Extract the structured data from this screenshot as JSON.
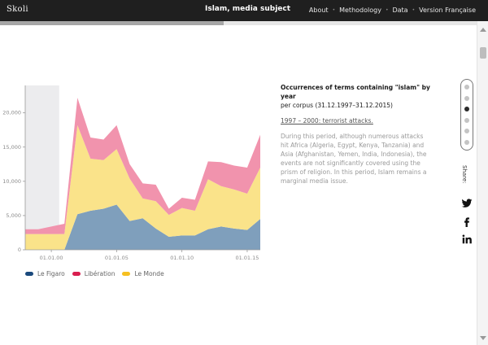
{
  "header": {
    "logo": "Skoli",
    "title": "Islam, media subject",
    "nav": [
      {
        "label": "About"
      },
      {
        "label": "Methodology"
      },
      {
        "label": "Data"
      },
      {
        "label": "Version Française"
      }
    ]
  },
  "progress": {
    "value": 0.47
  },
  "panel": {
    "heading": "Occurrences of terms containing \"islam\" by year",
    "subheading": "per corpus (31.12.1997–31.12.2015)",
    "period_link": "1997 – 2000: terrorist attacks.",
    "body": "During this period, although numerous attacks hit Africa (Algeria, Egypt, Kenya, Tanzania) and Asia (Afghanistan, Yemen, India, Indonesia), the events are not significantly covered using the prism of religion. In this period, Islam remains a marginal media issue."
  },
  "stepper": {
    "steps": 6,
    "active_index": 2
  },
  "share": {
    "label": "Share:",
    "icons": [
      "twitter-icon",
      "facebook-icon",
      "linkedin-icon"
    ]
  },
  "chart_data": {
    "type": "area",
    "stacked": true,
    "x": [
      1998,
      1999,
      2000,
      2001,
      2002,
      2003,
      2004,
      2005,
      2006,
      2007,
      2008,
      2009,
      2010,
      2011,
      2012,
      2013,
      2014,
      2015,
      2016
    ],
    "x_ticks": [
      {
        "year": 2000,
        "label": "01.01.00"
      },
      {
        "year": 2005,
        "label": "01.01.05"
      },
      {
        "year": 2010,
        "label": "01.01.10"
      },
      {
        "year": 2015,
        "label": "01.01.15"
      }
    ],
    "y_ticks": [
      {
        "value": 0,
        "label": "0"
      },
      {
        "value": 5000,
        "label": "5,000"
      },
      {
        "value": 10000,
        "label": "10,000"
      },
      {
        "value": 15000,
        "label": "15,000"
      },
      {
        "value": 20000,
        "label": "20,000"
      }
    ],
    "ylim": [
      0,
      24000
    ],
    "highlight_range": [
      1998,
      2000.6
    ],
    "series": [
      {
        "name": "Le Figaro",
        "color": "#7f9fbc",
        "legend_color": "#1b4a7d",
        "values": [
          0,
          0,
          0,
          0,
          5200,
          5700,
          6000,
          6600,
          4200,
          4600,
          3100,
          1900,
          2100,
          2100,
          3000,
          3400,
          3100,
          2900,
          4500
        ]
      },
      {
        "name": "Le Monde",
        "color": "#fae38a",
        "legend_color": "#f6c021",
        "values": [
          2300,
          2300,
          2300,
          2300,
          13000,
          7600,
          7100,
          8100,
          6200,
          2900,
          4000,
          3200,
          4000,
          3600,
          7300,
          5900,
          5700,
          5300,
          7500
        ]
      },
      {
        "name": "Libération",
        "color": "#f193ad",
        "legend_color": "#d91e4f",
        "values": [
          700,
          700,
          1100,
          1500,
          4000,
          3100,
          3000,
          3500,
          2100,
          2200,
          2400,
          900,
          1500,
          1600,
          2600,
          3500,
          3500,
          3800,
          4800
        ]
      }
    ],
    "legend": [
      "Le Figaro",
      "Libération",
      "Le Monde"
    ],
    "legend_placement": "bottom-left",
    "grid": false
  }
}
